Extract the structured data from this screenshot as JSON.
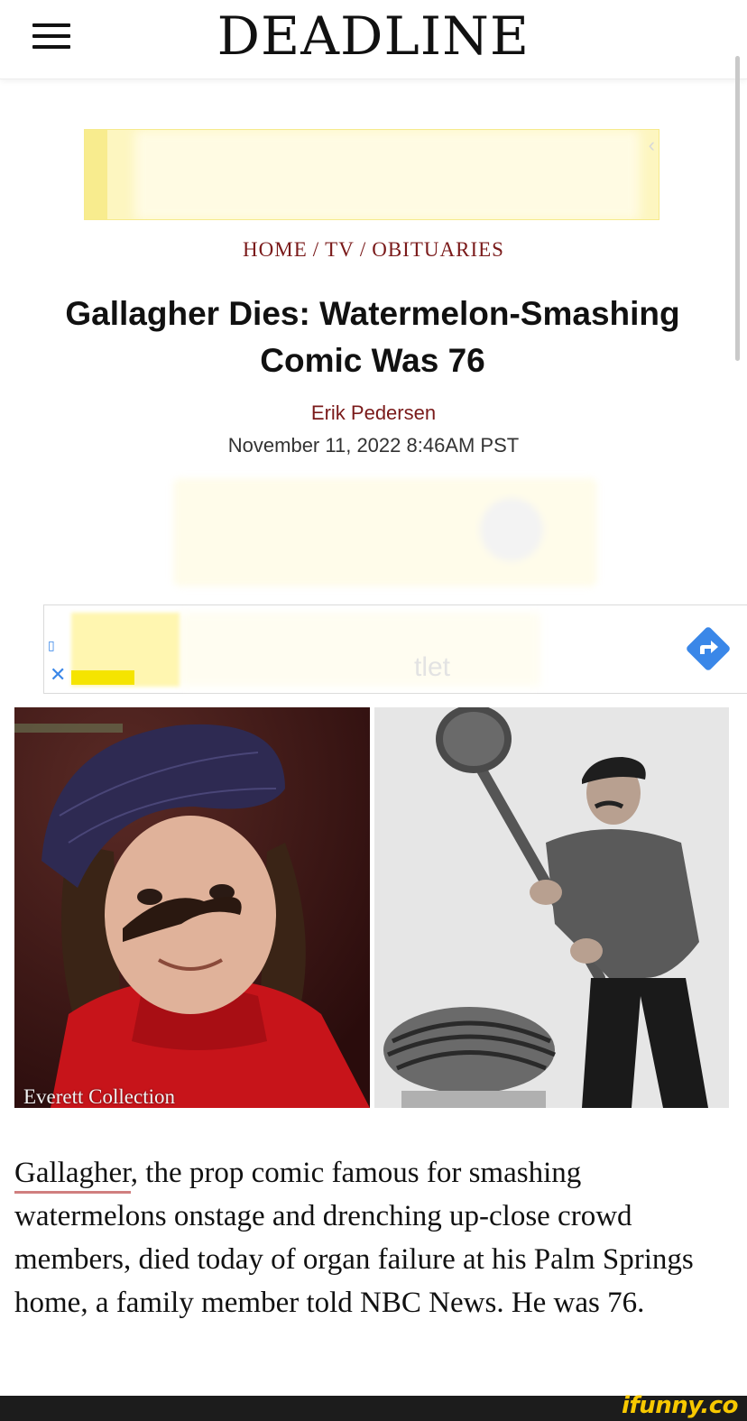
{
  "header": {
    "logo": "DEADLINE",
    "menu_icon": "hamburger-menu-icon"
  },
  "breadcrumb": {
    "items": [
      "HOME",
      "TV",
      "OBITUARIES"
    ],
    "separator": "/"
  },
  "article": {
    "title": "Gallagher Dies: Watermelon-Smashing Comic Was 76",
    "author": "Erik Pedersen",
    "date": "November 11, 2022 8:46AM PST",
    "photo_caption": "Everett Collection",
    "body_link": "Gallagher",
    "body_rest": ", the prop comic famous for smashing watermelons onstage and drenching up-close crowd members, died today of organ failure at his Palm Springs home, a family member told NBC News. He was 76."
  },
  "ad_banner": {
    "close_label": "✕",
    "faint_text": "tlet",
    "arrow_icon": "directions-arrow-icon"
  },
  "watermark": "ifunny.co",
  "colors": {
    "accent": "#7a1a1a",
    "link_underline": "#d07f7f",
    "ad_blue": "#3a87e8",
    "watermark": "#f7c800"
  }
}
